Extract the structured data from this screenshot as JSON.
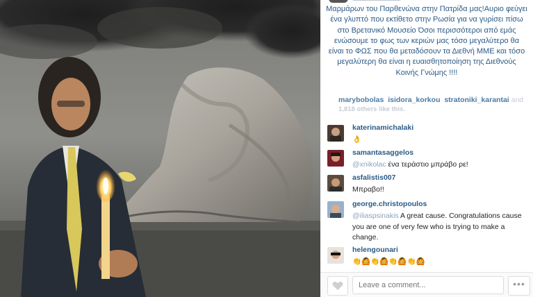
{
  "post": {
    "caption": "Μαρμάρων του Παρθενώνα στην Πατρίδα μας!Αυριο φεύγει ένα γλυπτό που εκτίθετο στην Ρωσία για να γυρίσει πίσω στο Βρετανικό Μουσείο Όσοι περισσότεροι από εμάς ενώσουμε το φως των κεριών μας τόσο μεγαλύτερο θα είναι το ΦΩΣ που θα μεταδόσουν τα Διεθνή ΜΜΕ και τόσο μεγαλύτερη θα είναι η ευαισθητοποίηση της Διεθνούς Κοινής Γνώμης !!!!"
  },
  "likes": {
    "users": [
      "marybobolas",
      "isidora_korkou",
      "stratoniki_karantai"
    ],
    "and_word": "and",
    "others_text": "1,818 others like this."
  },
  "comments": [
    {
      "user": "katerinamichalaki",
      "mention": "",
      "text": "👌"
    },
    {
      "user": "samantasaggelos",
      "mention": "@xnikolac",
      "text": "ένα τεράστιο μπράβο ρε!"
    },
    {
      "user": "asfalistis007",
      "mention": "",
      "text": "Μπραβο!!"
    },
    {
      "user": "george.christopoulos",
      "mention": "@iliaspsinakis",
      "text": "A great cause. Congratulations cause you are one of very few who is trying to make a change."
    },
    {
      "user": "helengounari",
      "mention": "",
      "text": "👏🙆👏🙆👏🙆👏🙆"
    }
  ],
  "composer": {
    "placeholder": "Leave a comment...",
    "more_label": "•••"
  },
  "icons": {
    "like": "heart-icon",
    "more": "more-options-icon"
  }
}
